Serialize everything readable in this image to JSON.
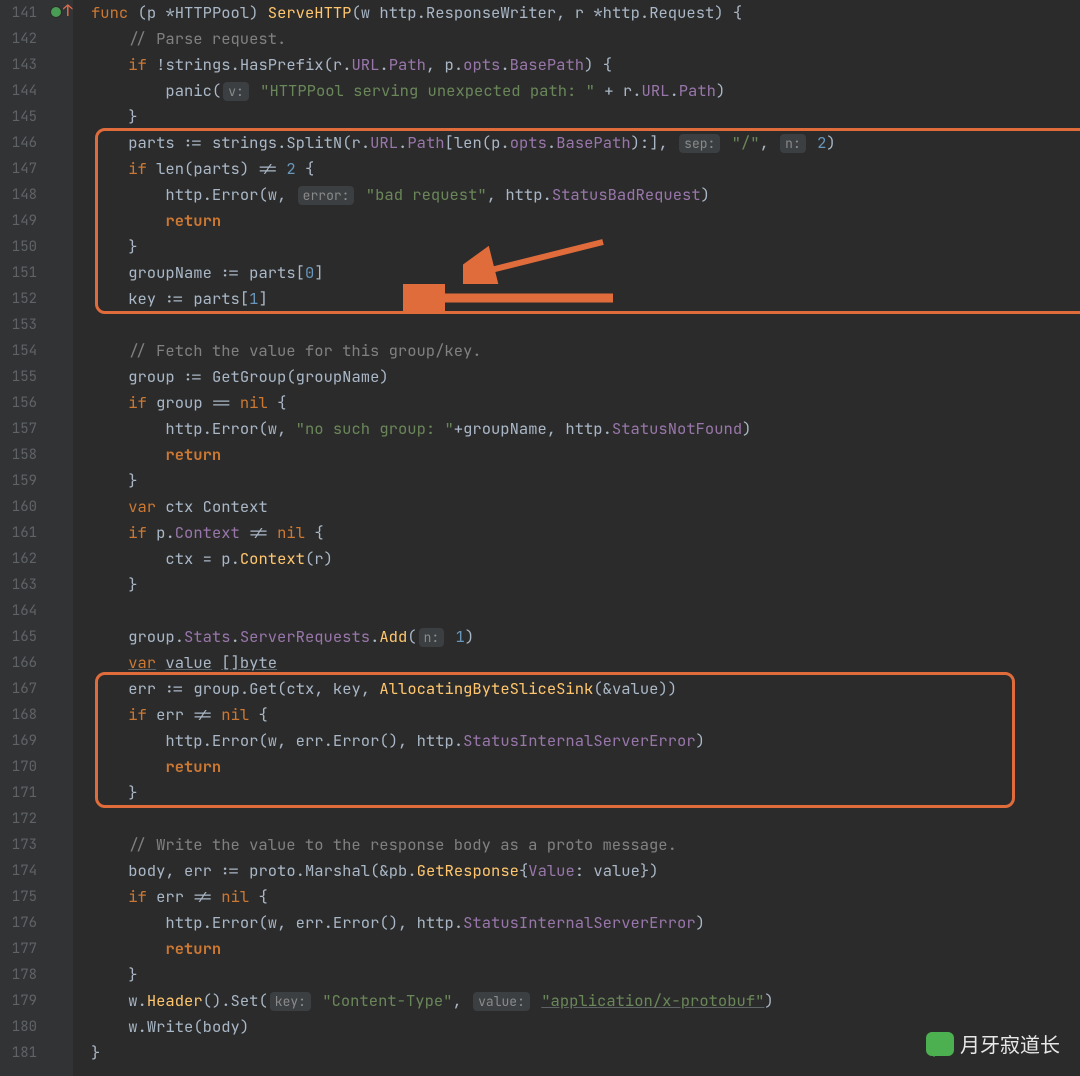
{
  "line_numbers": [
    "141",
    "142",
    "143",
    "144",
    "145",
    "146",
    "147",
    "148",
    "149",
    "150",
    "151",
    "152",
    "153",
    "154",
    "155",
    "156",
    "157",
    "158",
    "159",
    "160",
    "161",
    "162",
    "163",
    "164",
    "165",
    "166",
    "167",
    "168",
    "169",
    "170",
    "171",
    "172",
    "173",
    "174",
    "175",
    "176",
    "177",
    "178",
    "179",
    "180",
    "181"
  ],
  "gutter_icons": {
    "breakpoint_line": 141
  },
  "highlight_boxes": [
    {
      "top_line": 146,
      "bottom_line": 152
    },
    {
      "top_line": 167,
      "bottom_line": 171
    }
  ],
  "arrows": [
    {
      "target_line": 151
    },
    {
      "target_line": 152
    }
  ],
  "watermark": "月牙寂道长",
  "code": {
    "l141": {
      "func": "func",
      "p": "p",
      "star": "*",
      "type": "HTTPPool",
      "method": "ServeHTTP",
      "w": "w",
      "wt": "http",
      "wrt": "ResponseWriter",
      "r": "r",
      "rt": "http",
      "rrt": "Request",
      "ob": "{"
    },
    "l142": {
      "comment": "// Parse request."
    },
    "l143": {
      "if": "if",
      "not": "!",
      "pkg": "strings",
      "fn": "HasPrefix",
      "r": "r",
      "url": "URL",
      "path": "Path",
      "p": "p",
      "opts": "opts",
      "bp": "BasePath",
      "ob": "{"
    },
    "l144": {
      "panic": "panic",
      "hint": "v:",
      "str": "\"HTTPPool serving unexpected path: \"",
      "plus": "+",
      "r": "r",
      "url": "URL",
      "path": "Path"
    },
    "l145": {
      "cb": "}"
    },
    "l146": {
      "parts": "parts",
      "decl": ":=",
      "pkg": "strings",
      "fn": "SplitN",
      "r": "r",
      "url": "URL",
      "path": "Path",
      "len": "len",
      "p": "p",
      "opts": "opts",
      "bp": "BasePath",
      "hint1": "sep:",
      "str": "\"/\"",
      "hint2": "n:",
      "num": "2"
    },
    "l147": {
      "if": "if",
      "len": "len",
      "parts": "parts",
      "ne": "!=",
      "num": "2",
      "ob": "{"
    },
    "l148": {
      "http": "http",
      "fn": "Error",
      "w": "w",
      "hint": "error:",
      "str": "\"bad request\"",
      "http2": "http",
      "sc": "StatusBadRequest"
    },
    "l149": {
      "ret": "return"
    },
    "l150": {
      "cb": "}"
    },
    "l151": {
      "gn": "groupName",
      "decl": ":=",
      "parts": "parts",
      "idx": "0"
    },
    "l152": {
      "key": "key",
      "decl": ":=",
      "parts": "parts",
      "idx": "1"
    },
    "l154": {
      "comment": "// Fetch the value for this group/key."
    },
    "l155": {
      "group": "group",
      "decl": ":=",
      "fn": "GetGroup",
      "gn": "groupName"
    },
    "l156": {
      "if": "if",
      "group": "group",
      "eq": "==",
      "nil": "nil",
      "ob": "{"
    },
    "l157": {
      "http": "http",
      "fn": "Error",
      "w": "w",
      "str": "\"no such group: \"",
      "plus": "+",
      "gn": "groupName",
      "http2": "http",
      "sc": "StatusNotFound"
    },
    "l158": {
      "ret": "return"
    },
    "l159": {
      "cb": "}"
    },
    "l160": {
      "var": "var",
      "ctx": "ctx",
      "type": "Context"
    },
    "l161": {
      "if": "if",
      "p": "p",
      "ctx": "Context",
      "ne": "!=",
      "nil": "nil",
      "ob": "{"
    },
    "l162": {
      "ctx": "ctx",
      "eq": "=",
      "p": "p",
      "ctxf": "Context",
      "r": "r"
    },
    "l163": {
      "cb": "}"
    },
    "l165": {
      "group": "group",
      "stats": "Stats",
      "sr": "ServerRequests",
      "fn": "Add",
      "hint": "n:",
      "num": "1"
    },
    "l166": {
      "var": "var",
      "value": "value",
      "type": "[]byte"
    },
    "l167": {
      "err": "err",
      "decl": ":=",
      "group": "group",
      "fn": "Get",
      "ctx": "ctx",
      "key": "key",
      "abs": "AllocatingByteSliceSink",
      "amp": "&",
      "value": "value"
    },
    "l168": {
      "if": "if",
      "err": "err",
      "ne": "!=",
      "nil": "nil",
      "ob": "{"
    },
    "l169": {
      "http": "http",
      "fn": "Error",
      "w": "w",
      "err": "err",
      "errf": "Error",
      "http2": "http",
      "sc": "StatusInternalServerError"
    },
    "l170": {
      "ret": "return"
    },
    "l171": {
      "cb": "}"
    },
    "l173": {
      "comment": "// Write the value to the response body as a proto message."
    },
    "l174": {
      "body": "body",
      "err": "err",
      "decl": ":=",
      "proto": "proto",
      "fn": "Marshal",
      "amp": "&",
      "pb": "pb",
      "gr": "GetResponse",
      "val": "Value",
      "value": "value"
    },
    "l175": {
      "if": "if",
      "err": "err",
      "ne": "!=",
      "nil": "nil",
      "ob": "{"
    },
    "l176": {
      "http": "http",
      "fn": "Error",
      "w": "w",
      "err": "err",
      "errf": "Error",
      "http2": "http",
      "sc": "StatusInternalServerError"
    },
    "l177": {
      "ret": "return"
    },
    "l178": {
      "cb": "}"
    },
    "l179": {
      "w": "w",
      "fn": "Header",
      "fn2": "Set",
      "hint1": "key:",
      "str1": "\"Content-Type\"",
      "hint2": "value:",
      "str2": "\"application/x-protobuf\""
    },
    "l180": {
      "w": "w",
      "fn": "Write",
      "body": "body"
    },
    "l181": {
      "cb": "}"
    }
  }
}
